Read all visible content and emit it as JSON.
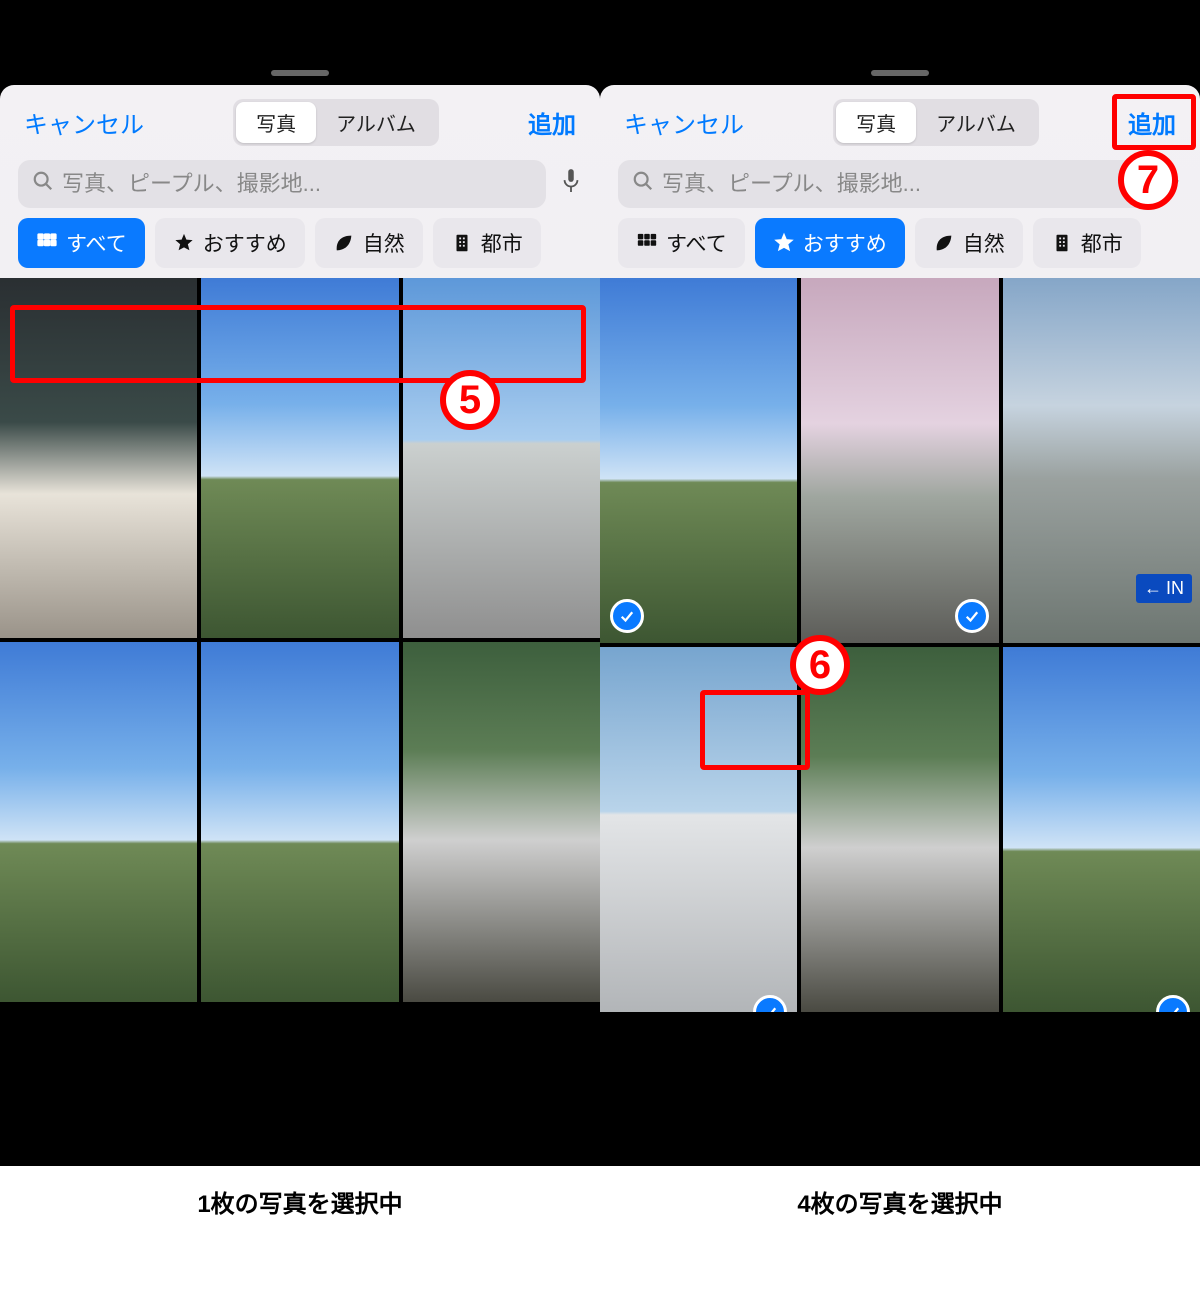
{
  "panels": [
    {
      "nav": {
        "cancel": "キャンセル",
        "add": "追加"
      },
      "segments": {
        "photos": "写真",
        "albums": "アルバム",
        "active": "photos"
      },
      "search": {
        "placeholder": "写真、ピープル、撮影地..."
      },
      "filters": {
        "active": "all",
        "items": [
          {
            "key": "all",
            "label": "すべて",
            "icon": "grid-icon"
          },
          {
            "key": "featured",
            "label": "おすすめ",
            "icon": "star-icon"
          },
          {
            "key": "nature",
            "label": "自然",
            "icon": "leaf-icon"
          },
          {
            "key": "city",
            "label": "都市",
            "icon": "building-icon"
          }
        ]
      },
      "photos_row1": [
        "indoor",
        "sky",
        "bridge"
      ],
      "photos_row2": [
        "sky",
        "sky",
        "water"
      ],
      "footer": "1枚の写真を選択中",
      "annotations": {
        "step5": "5"
      }
    },
    {
      "nav": {
        "cancel": "キャンセル",
        "add": "追加"
      },
      "segments": {
        "photos": "写真",
        "albums": "アルバム",
        "active": "photos"
      },
      "search": {
        "placeholder": "写真、ピープル、撮影地..."
      },
      "filters": {
        "active": "featured",
        "items": [
          {
            "key": "all",
            "label": "すべて",
            "icon": "grid-icon"
          },
          {
            "key": "featured",
            "label": "おすすめ",
            "icon": "star-icon"
          },
          {
            "key": "nature",
            "label": "自然",
            "icon": "leaf-icon"
          },
          {
            "key": "city",
            "label": "都市",
            "icon": "building-icon"
          }
        ]
      },
      "photos_row1": [
        {
          "style": "sky",
          "selected": true
        },
        {
          "style": "blossom",
          "selected": true
        },
        {
          "style": "street",
          "selected": false
        }
      ],
      "photos_row2": [
        {
          "style": "towers",
          "selected_partial": true
        },
        {
          "style": "water",
          "selected": false
        },
        {
          "style": "sky",
          "selected_partial": true
        }
      ],
      "footer": "4枚の写真を選択中",
      "annotations": {
        "step6": "6",
        "step7": "7"
      },
      "in_sign": "IN"
    }
  ],
  "colors": {
    "accent": "#007aff",
    "annotation": "#ff0000"
  }
}
